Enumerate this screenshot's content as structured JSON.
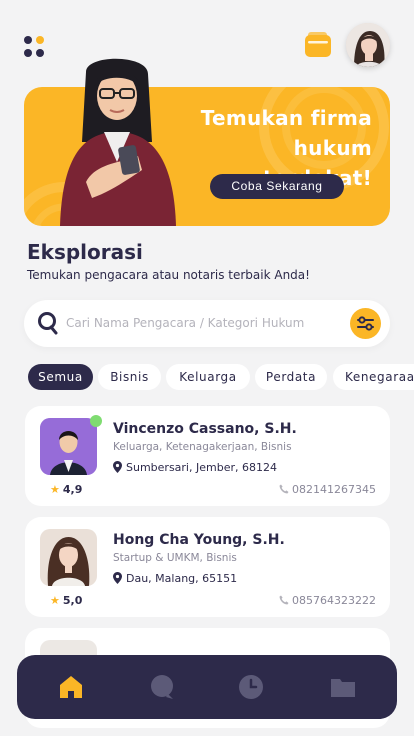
{
  "colors": {
    "primary": "#2d2a4a",
    "accent": "#fbb626",
    "background": "#f3f3f4",
    "online": "#7fdc71"
  },
  "header": {
    "menu_icon": "grid-dots-icon",
    "wallet_icon": "wallet-icon",
    "avatar": "user-avatar"
  },
  "banner": {
    "title_line1": "Temukan firma",
    "title_line2": "hukum terdekat!",
    "cta": "Coba Sekarang"
  },
  "section": {
    "title": "Eksplorasi",
    "subtitle": "Temukan pengacara atau notaris terbaik Anda!"
  },
  "search": {
    "placeholder": "Cari Nama Pengacara / Kategori Hukum",
    "value": "",
    "filter_icon": "filter-sliders-icon"
  },
  "categories": [
    "Semua",
    "Bisnis",
    "Keluarga",
    "Perdata",
    "Kenegaraan"
  ],
  "selected_category": "Semua",
  "lawyers": [
    {
      "name": "Vincenzo Cassano, S.H.",
      "categories": "Keluarga, Ketenagakerjaan, Bisnis",
      "location": "Sumbersari, Jember, 68124",
      "rating": "4,9",
      "phone": "082141267345",
      "online": true
    },
    {
      "name": "Hong Cha Young, S.H.",
      "categories": "Startup & UMKM, Bisnis",
      "location": "Dau, Malang, 65151",
      "rating": "5,0",
      "phone": "085764323222",
      "online": false
    }
  ],
  "nav": [
    {
      "icon": "home-icon",
      "active": true
    },
    {
      "icon": "chat-icon",
      "active": false
    },
    {
      "icon": "clock-icon",
      "active": false
    },
    {
      "icon": "folder-icon",
      "active": false
    }
  ]
}
